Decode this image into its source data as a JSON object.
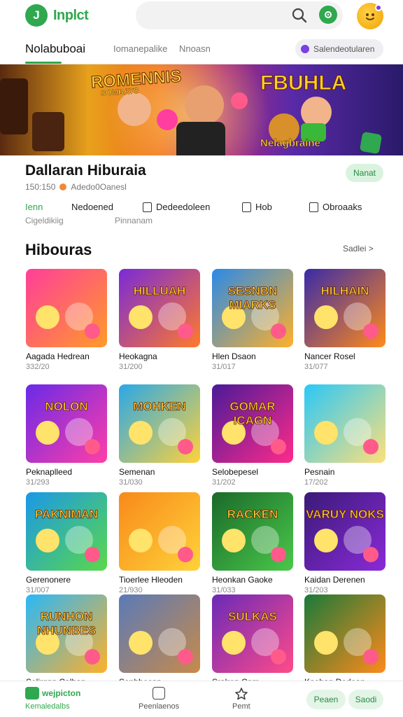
{
  "app": {
    "logo_text": "Inplct",
    "logo_letter": "J"
  },
  "tabs": [
    {
      "label": "Nolabuboai",
      "active": true
    },
    {
      "label": "Iomanepalike",
      "active": false
    },
    {
      "label": "Nnoasn",
      "active": false
    }
  ],
  "tab_chip": {
    "label": "Salendeotularen"
  },
  "banner": {
    "title_left": "ROMENNIS",
    "title_left_sub": "SOMBAYS",
    "title_right": "FBUHLA",
    "subtitle": "Nelagbraine"
  },
  "detail": {
    "title": "Dallaran Hiburaia",
    "meta_count": "150:150",
    "meta_text": "Adedo0Oanesl",
    "status_button": "Nanat",
    "actions": [
      {
        "label": "Ienn",
        "sub": "Cigeldikiig",
        "icon": ""
      },
      {
        "label": "Nedoened",
        "sub": "Pinnanam",
        "icon": ""
      },
      {
        "label": "Dedeedoleen",
        "sub": "",
        "icon": "clipboard-icon"
      },
      {
        "label": "Hob",
        "sub": "",
        "icon": "document-icon"
      },
      {
        "label": "Obroaaks",
        "sub": "",
        "icon": "calendar-icon"
      }
    ]
  },
  "section": {
    "title": "Hibouras",
    "see_all": "Sadlei >"
  },
  "games": [
    {
      "title": "Aagada Hedrean",
      "meta": "332/20",
      "label": "",
      "c1": "#ff3e9a",
      "c2": "#ff9a2a"
    },
    {
      "title": "Heokagna",
      "meta": "31/200",
      "label": "HILLUAH",
      "c1": "#7a2ad8",
      "c2": "#ff7a2a"
    },
    {
      "title": "Hlen Dsaon",
      "meta": "31/017",
      "label": "SESNBN MIARKS",
      "c1": "#2a8ae8",
      "c2": "#ffb02a"
    },
    {
      "title": "Nancer Rosel",
      "meta": "31/077",
      "label": "HILHAIN",
      "c1": "#3a2aa8",
      "c2": "#ff8a1a"
    },
    {
      "title": "Peknaplleed",
      "meta": "31/293",
      "label": "NOLON",
      "c1": "#6a2ae8",
      "c2": "#ff3ea8"
    },
    {
      "title": "Semenan",
      "meta": "31/030",
      "label": "MOHKEN",
      "c1": "#2aa8e8",
      "c2": "#ffd23a"
    },
    {
      "title": "Selobepesel",
      "meta": "31/202",
      "label": "GOMAR ICAGN",
      "c1": "#4a1a98",
      "c2": "#ff2a8a"
    },
    {
      "title": "Pesnain",
      "meta": "17/202",
      "label": "",
      "c1": "#2ac8f8",
      "c2": "#ffe07a"
    },
    {
      "title": "Gerenonere",
      "meta": "31/007",
      "label": "PAKNIMAN",
      "c1": "#1a98e8",
      "c2": "#5ad84a"
    },
    {
      "title": "Tioerlee Hleoden",
      "meta": "21/930",
      "label": "",
      "c1": "#f88a1a",
      "c2": "#ffd23a"
    },
    {
      "title": "Heonkan Gaoke",
      "meta": "31/033",
      "label": "RACKEN",
      "c1": "#1a6a2a",
      "c2": "#4ac84a"
    },
    {
      "title": "Kaidan Derenen",
      "meta": "31/203",
      "label": "VARUY NOKS",
      "c1": "#3a1a78",
      "c2": "#8a2ad8"
    },
    {
      "title": "Selirgan Calhan",
      "meta": "",
      "label": "RUNHON NHUNBES",
      "c1": "#2ab8f8",
      "c2": "#ffb02a"
    },
    {
      "title": "Sephbecan",
      "meta": "",
      "label": "",
      "c1": "#5a7ab8",
      "c2": "#c88a4a"
    },
    {
      "title": "Sralren Cam",
      "meta": "",
      "label": "SULKAS",
      "c1": "#6a2ab8",
      "c2": "#ff4a8a"
    },
    {
      "title": "Kaeban Dedean",
      "meta": "",
      "label": "",
      "c1": "#1a7a3a",
      "c2": "#ff8a1a"
    }
  ],
  "bottom_nav": {
    "brand": "wejpicton",
    "home_label": "Kemaledalbs",
    "item2": "Peenlaenos",
    "item3": "Pemt",
    "btn1": "Peaen",
    "btn2": "Saodi"
  },
  "colors": {
    "accent": "#2fa84f",
    "chip_bg": "#efeff3",
    "status_bg": "#d9f3de"
  }
}
